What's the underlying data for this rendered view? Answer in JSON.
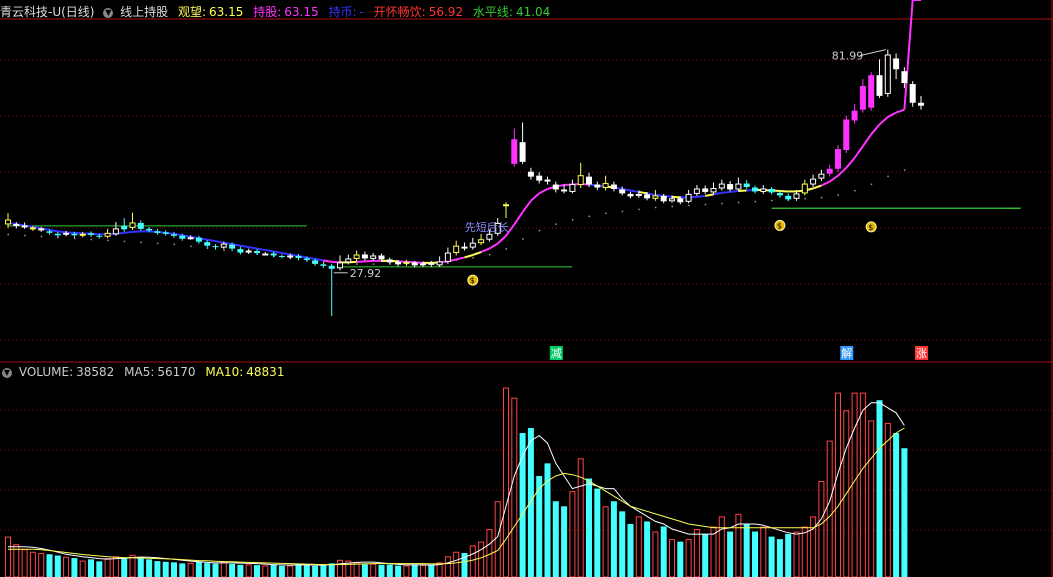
{
  "header": {
    "stock": "青云科技-U(日线)",
    "indicator": "线上持股",
    "items": [
      {
        "label": "观望:",
        "value": "63.15",
        "color": "#ffff55"
      },
      {
        "label": "持股:",
        "value": "63.15",
        "color": "#ff33ff"
      },
      {
        "label": "持币:",
        "value": "-",
        "color": "#3333ff"
      },
      {
        "label": "开怀畅饮:",
        "value": "56.92",
        "color": "#ff3333"
      },
      {
        "label": "水平线:",
        "value": "41.04",
        "color": "#33cc33"
      }
    ]
  },
  "volume_header": {
    "items": [
      {
        "label": "VOLUME:",
        "value": "38582",
        "color": "#cccccc"
      },
      {
        "label": "MA5:",
        "value": "56170",
        "color": "#cccccc"
      },
      {
        "label": "MA10:",
        "value": "48831",
        "color": "#ffff55"
      }
    ]
  },
  "annotations": {
    "high_label": "81.99",
    "low_label": "27.92",
    "pattern_text": "先短后长",
    "signal_reduce": "减",
    "signal_release": "解",
    "signal_rise": "涨"
  },
  "colors": {
    "up": "#ff4444",
    "down": "#44ffff",
    "grid": "#7a1010",
    "ma_pink": "#ff33ff",
    "ma_blue": "#3333ff",
    "ma_yellow": "#ffff55",
    "level_green": "#33cc33"
  },
  "chart_data": {
    "type": "candlestick",
    "price_range": [
      20,
      88
    ],
    "volume_max": 78000,
    "candles": [
      [
        46.5,
        47.5,
        45.8,
        48.8
      ],
      [
        46.2,
        46.6,
        45.7,
        47.0
      ],
      [
        45.9,
        46.3,
        45.6,
        46.9
      ],
      [
        45.6,
        45.9,
        45.2,
        46.2
      ],
      [
        45.4,
        45.7,
        45.0,
        46.0
      ],
      [
        45.1,
        44.8,
        44.4,
        45.5
      ],
      [
        44.6,
        44.3,
        43.9,
        45.0
      ],
      [
        44.5,
        44.8,
        44.1,
        45.2
      ],
      [
        44.6,
        44.3,
        43.8,
        45.0
      ],
      [
        44.2,
        44.6,
        43.9,
        45.0
      ],
      [
        44.7,
        44.4,
        44.0,
        45.1
      ],
      [
        44.2,
        44.0,
        43.6,
        44.6
      ],
      [
        44.0,
        44.8,
        43.7,
        45.6
      ],
      [
        44.5,
        45.7,
        44.2,
        47.0
      ],
      [
        46.2,
        45.5,
        45.0,
        47.8
      ],
      [
        45.8,
        46.9,
        45.4,
        48.9
      ],
      [
        46.8,
        45.6,
        45.2,
        47.3
      ],
      [
        45.6,
        45.3,
        44.9,
        46.0
      ],
      [
        45.1,
        44.8,
        44.4,
        45.6
      ],
      [
        44.9,
        44.6,
        44.2,
        45.3
      ],
      [
        44.5,
        44.2,
        43.8,
        45.0
      ],
      [
        44.2,
        43.6,
        43.2,
        44.6
      ],
      [
        43.7,
        43.9,
        43.4,
        44.3
      ],
      [
        43.8,
        43.0,
        42.6,
        44.2
      ],
      [
        42.9,
        42.2,
        41.8,
        43.3
      ],
      [
        42.1,
        41.9,
        41.4,
        42.5
      ],
      [
        41.8,
        42.6,
        41.5,
        43.0
      ],
      [
        42.4,
        41.6,
        41.1,
        42.8
      ],
      [
        41.5,
        40.8,
        40.4,
        42.0
      ],
      [
        40.8,
        41.2,
        40.5,
        41.6
      ],
      [
        41.1,
        40.7,
        40.3,
        41.5
      ],
      [
        40.5,
        40.6,
        40.2,
        40.9
      ],
      [
        40.6,
        40.2,
        39.8,
        41.0
      ],
      [
        40.1,
        39.9,
        39.6,
        40.4
      ],
      [
        39.8,
        40.2,
        39.5,
        40.6
      ],
      [
        40.1,
        39.7,
        39.2,
        40.5
      ],
      [
        39.6,
        39.3,
        38.9,
        40.0
      ],
      [
        39.2,
        38.5,
        38.1,
        39.6
      ],
      [
        38.4,
        38.1,
        37.7,
        38.8
      ],
      [
        38.1,
        37.5,
        27.92,
        38.5
      ],
      [
        37.6,
        38.8,
        37.2,
        40.2
      ],
      [
        38.8,
        39.6,
        38.4,
        40.4
      ],
      [
        39.5,
        40.4,
        39.0,
        41.2
      ],
      [
        40.4,
        39.6,
        39.2,
        41.0
      ],
      [
        39.5,
        40.2,
        39.1,
        40.7
      ],
      [
        40.2,
        39.4,
        39.0,
        40.6
      ],
      [
        39.4,
        38.8,
        38.5,
        39.8
      ],
      [
        38.9,
        38.4,
        38.0,
        39.3
      ],
      [
        38.5,
        38.9,
        38.1,
        39.3
      ],
      [
        38.8,
        38.2,
        37.8,
        39.1
      ],
      [
        38.3,
        38.6,
        37.9,
        39.0
      ],
      [
        38.7,
        38.3,
        37.9,
        39.1
      ],
      [
        38.2,
        39.0,
        37.9,
        40.0
      ],
      [
        38.9,
        40.8,
        38.5,
        41.8
      ],
      [
        40.7,
        42.2,
        40.2,
        43.2
      ],
      [
        42.0,
        41.6,
        41.2,
        42.8
      ],
      [
        41.8,
        42.8,
        41.4,
        43.8
      ],
      [
        42.7,
        43.5,
        42.3,
        44.6
      ],
      [
        43.4,
        44.6,
        43.0,
        45.5
      ],
      [
        44.6,
        46.8,
        44.2,
        47.8
      ],
      [
        50.2,
        50.6,
        47.8,
        51.0
      ],
      [
        58.8,
        63.8,
        58.2,
        66.0
      ],
      [
        63.2,
        59.2,
        58.8,
        67.2
      ],
      [
        57.2,
        56.2,
        55.6,
        58.0
      ],
      [
        56.4,
        55.4,
        54.8,
        57.1
      ],
      [
        55.6,
        55.2,
        54.6,
        56.2
      ],
      [
        54.6,
        53.6,
        53.0,
        55.2
      ],
      [
        53.6,
        53.2,
        52.8,
        54.6
      ],
      [
        53.1,
        54.7,
        52.8,
        55.6
      ],
      [
        54.5,
        56.5,
        53.9,
        59.0
      ],
      [
        56.2,
        54.6,
        54.1,
        57.0
      ],
      [
        54.6,
        54.0,
        53.5,
        55.2
      ],
      [
        53.9,
        54.9,
        53.4,
        56.4
      ],
      [
        54.6,
        53.7,
        53.2,
        55.2
      ],
      [
        53.6,
        52.8,
        52.4,
        54.2
      ],
      [
        52.7,
        52.2,
        51.8,
        53.1
      ],
      [
        52.3,
        52.7,
        51.9,
        53.4
      ],
      [
        52.6,
        51.8,
        51.4,
        53.1
      ],
      [
        51.7,
        52.4,
        51.3,
        53.5
      ],
      [
        52.3,
        51.2,
        50.8,
        52.7
      ],
      [
        51.2,
        51.8,
        50.9,
        52.4
      ],
      [
        51.8,
        51.0,
        50.6,
        52.2
      ],
      [
        51.1,
        52.7,
        50.8,
        53.5
      ],
      [
        52.7,
        53.8,
        52.3,
        54.5
      ],
      [
        53.8,
        53.1,
        52.7,
        54.4
      ],
      [
        53.0,
        53.9,
        52.6,
        55.0
      ],
      [
        53.8,
        54.8,
        53.4,
        55.6
      ],
      [
        54.7,
        53.6,
        53.2,
        55.3
      ],
      [
        53.6,
        54.8,
        53.3,
        56.0
      ],
      [
        54.8,
        54.1,
        53.7,
        55.5
      ],
      [
        54.0,
        53.2,
        52.8,
        54.4
      ],
      [
        53.1,
        53.8,
        52.7,
        54.5
      ],
      [
        53.7,
        53.0,
        52.6,
        54.1
      ],
      [
        52.9,
        52.4,
        51.9,
        53.3
      ],
      [
        52.3,
        51.6,
        51.2,
        52.8
      ],
      [
        51.7,
        52.8,
        51.3,
        53.5
      ],
      [
        52.8,
        54.8,
        52.4,
        55.6
      ],
      [
        54.6,
        55.8,
        54.1,
        56.6
      ],
      [
        55.8,
        56.8,
        55.3,
        57.6
      ],
      [
        56.8,
        57.8,
        56.2,
        58.6
      ],
      [
        57.8,
        61.8,
        57.2,
        62.6
      ],
      [
        61.6,
        67.8,
        61.0,
        68.6
      ],
      [
        67.6,
        69.6,
        67.0,
        71.0
      ],
      [
        69.8,
        74.6,
        69.2,
        76.0
      ],
      [
        70.2,
        76.8,
        69.6,
        77.4
      ],
      [
        76.8,
        72.6,
        72.2,
        80.0
      ],
      [
        73.0,
        81.0,
        72.4,
        81.99
      ],
      [
        80.2,
        78.0,
        76.0,
        81.2
      ],
      [
        77.6,
        75.2,
        74.2,
        78.4
      ],
      [
        75.0,
        71.2,
        70.4,
        75.6
      ],
      [
        71.2,
        70.6,
        69.8,
        72.6
      ]
    ],
    "volumes": [
      16000,
      13000,
      11000,
      10000,
      9500,
      9000,
      8500,
      8000,
      7500,
      6500,
      7000,
      6200,
      7500,
      8200,
      7600,
      8800,
      7800,
      7000,
      6300,
      6000,
      5800,
      5400,
      5600,
      6200,
      5500,
      5300,
      6000,
      5200,
      4800,
      5000,
      4700,
      4600,
      5000,
      4400,
      4600,
      5200,
      4800,
      4400,
      4600,
      5400,
      6800,
      6500,
      5800,
      5000,
      5300,
      4800,
      4900,
      4500,
      4600,
      5000,
      4800,
      4600,
      5800,
      8200,
      10000,
      9500,
      12500,
      14000,
      19000,
      30000,
      75000,
      71000,
      57000,
      59000,
      40000,
      45000,
      30000,
      28000,
      34000,
      47000,
      39000,
      35000,
      28000,
      30000,
      26000,
      21000,
      24000,
      22000,
      18000,
      20000,
      15000,
      14000,
      15000,
      19000,
      17000,
      20000,
      24000,
      18000,
      25000,
      21000,
      18000,
      20000,
      16000,
      15000,
      17000,
      18000,
      20000,
      24000,
      38000,
      54000,
      73000,
      66000,
      73000,
      73000,
      62000,
      70000,
      61000,
      57000,
      51000
    ],
    "ma_pink": [
      46.8,
      46.6,
      46.3,
      46.0,
      45.7,
      45.4,
      45.1,
      44.9,
      44.8,
      44.7,
      44.6,
      44.5,
      44.5,
      44.6,
      44.8,
      45.0,
      45.1,
      45.1,
      45.0,
      44.8,
      44.6,
      44.3,
      44.0,
      43.7,
      43.4,
      43.1,
      42.8,
      42.5,
      42.2,
      41.9,
      41.6,
      41.3,
      41.0,
      40.7,
      40.4,
      40.1,
      39.8,
      39.5,
      39.2,
      38.9,
      38.8,
      38.8,
      38.9,
      39.0,
      39.1,
      39.1,
      39.1,
      39.0,
      38.9,
      38.8,
      38.7,
      38.7,
      38.8,
      39.0,
      39.4,
      39.8,
      40.3,
      40.9,
      41.6,
      42.6,
      44.2,
      46.5,
      49.0,
      51.3,
      52.8,
      53.7,
      54.2,
      54.5,
      54.6,
      54.7,
      54.6,
      54.4,
      54.2,
      54.0,
      53.7,
      53.4,
      53.1,
      52.8,
      52.5,
      52.3,
      52.1,
      52.0,
      52.0,
      52.1,
      52.3,
      52.6,
      52.9,
      53.1,
      53.3,
      53.4,
      53.5,
      53.5,
      53.4,
      53.3,
      53.2,
      53.2,
      53.4,
      53.8,
      54.4,
      55.2,
      56.4,
      58.0,
      60.0,
      62.4,
      64.8,
      66.8,
      68.3,
      69.2,
      69.8
    ],
    "ma_dotted": [
      44.5,
      44.4,
      44.3,
      44.2,
      44.1,
      44.0,
      43.9,
      43.8,
      43.7,
      43.6,
      43.5,
      43.4,
      43.3,
      43.2,
      43.1,
      43.0,
      42.9,
      42.8,
      42.7,
      42.6,
      42.5,
      42.3,
      42.1,
      41.9,
      41.7,
      41.5,
      41.3,
      41.1,
      40.9,
      40.7,
      40.5,
      40.3,
      40.1,
      39.9,
      39.7,
      39.5,
      39.3,
      39.1,
      38.9,
      38.7,
      38.6,
      38.5,
      38.5,
      38.5,
      38.5,
      38.5,
      38.5,
      38.5,
      38.5,
      38.6,
      38.7,
      38.8,
      38.9,
      39.1,
      39.3,
      39.5,
      39.8,
      40.1,
      40.4,
      40.8,
      41.6,
      42.6,
      43.6,
      44.5,
      45.3,
      46.0,
      46.6,
      47.1,
      47.5,
      47.9,
      48.2,
      48.5,
      48.8,
      49.0,
      49.2,
      49.4,
      49.6,
      49.8,
      50.0,
      50.1,
      50.2,
      50.3,
      50.4,
      50.5,
      50.6,
      50.7,
      50.8,
      50.9,
      51.0,
      51.1,
      51.2,
      51.3,
      51.4,
      51.5,
      51.6,
      51.7,
      51.8,
      51.9,
      52.0,
      52.2,
      52.5,
      52.9,
      53.4,
      54.0,
      54.7,
      55.5,
      56.3,
      57.0,
      57.6
    ],
    "vol_ma5": [
      12000,
      12000,
      12000,
      11800,
      11300,
      10600,
      9800,
      9000,
      8500,
      8000,
      7700,
      7300,
      7100,
      7300,
      7400,
      7700,
      7900,
      7800,
      7600,
      7300,
      7000,
      6600,
      6300,
      6000,
      5800,
      5600,
      5600,
      5600,
      5500,
      5400,
      5300,
      5100,
      4900,
      4800,
      4700,
      4800,
      4800,
      4700,
      4700,
      4900,
      5200,
      5500,
      5800,
      5900,
      5900,
      5600,
      5300,
      5000,
      4800,
      4800,
      4800,
      4700,
      4900,
      5600,
      6600,
      7800,
      9100,
      10800,
      13000,
      16000,
      28000,
      40000,
      48000,
      54000,
      56000,
      53000,
      45000,
      40000,
      35000,
      36000,
      37000,
      36000,
      35000,
      35000,
      31000,
      28000,
      26000,
      24000,
      22000,
      21000,
      19000,
      18000,
      17000,
      17000,
      17000,
      17000,
      19000,
      19500,
      21000,
      21000,
      21000,
      20500,
      19500,
      18500,
      17500,
      17000,
      17500,
      19000,
      23000,
      30000,
      41000,
      51000,
      59000,
      66000,
      69000,
      69000,
      67000,
      65000,
      60000
    ],
    "vol_ma10": [
      11000,
      11000,
      11000,
      11000,
      10800,
      10500,
      10100,
      9700,
      9300,
      8900,
      8600,
      8300,
      8000,
      7800,
      7700,
      7600,
      7500,
      7400,
      7300,
      7200,
      7100,
      6900,
      6700,
      6500,
      6400,
      6200,
      6100,
      6000,
      5900,
      5800,
      5700,
      5600,
      5500,
      5400,
      5300,
      5200,
      5100,
      5000,
      4900,
      4900,
      4900,
      5000,
      5100,
      5200,
      5300,
      5300,
      5300,
      5300,
      5300,
      5300,
      5300,
      5200,
      5200,
      5300,
      5600,
      6000,
      6700,
      7600,
      8900,
      10500,
      15000,
      20000,
      25000,
      30000,
      35000,
      38000,
      40000,
      41000,
      40500,
      39500,
      38000,
      36000,
      34000,
      32000,
      30000,
      28000,
      27000,
      26000,
      25000,
      24000,
      23000,
      22000,
      21000,
      20500,
      20000,
      19500,
      19500,
      19500,
      19500,
      19500,
      19500,
      19500,
      19500,
      19500,
      19500,
      19500,
      19500,
      19500,
      21000,
      24000,
      28000,
      33000,
      38000,
      43000,
      47000,
      51000,
      54000,
      57000,
      59000
    ]
  }
}
